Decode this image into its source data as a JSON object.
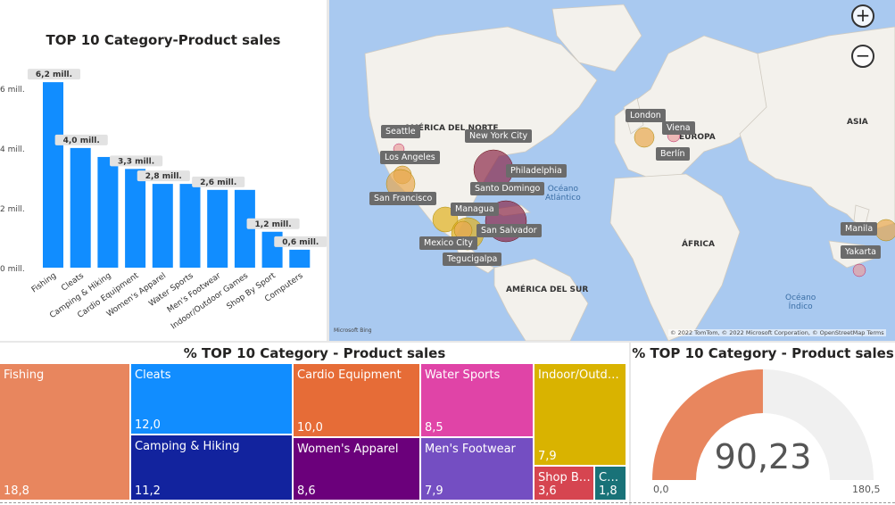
{
  "bar_chart": {
    "title": "TOP 10 Category-Product sales",
    "y_ticks": [
      "0 mill.",
      "2 mill.",
      "4 mill.",
      "6 mill."
    ],
    "bar_color": "#118DFF",
    "chart_data": {
      "type": "bar",
      "title": "TOP 10 Category-Product sales",
      "categories": [
        "Fishing",
        "Cleats",
        "Camping & Hiking",
        "Cardio Equipment",
        "Women's Apparel",
        "Water Sports",
        "Men's Footwear",
        "Indoor/Outdoor Games",
        "Shop By Sport",
        "Computers"
      ],
      "values": [
        6.2,
        4.0,
        3.7,
        3.3,
        2.8,
        2.8,
        2.6,
        2.6,
        1.2,
        0.6
      ],
      "data_labels": [
        "6,2 mill.",
        "4,0 mill.",
        "",
        "3,3 mill.",
        "2,8 mill.",
        "",
        "2,6 mill.",
        "",
        "1,2 mill.",
        "0,6 mill."
      ],
      "ylim": [
        0,
        6.8
      ]
    }
  },
  "map": {
    "continents": [
      "AMÉRICA DEL NORTE",
      "EUROPA",
      "ASIA",
      "ÁFRICA",
      "AMÉRICA DEL SUR"
    ],
    "oceans": [
      [
        "Océano",
        "Atlántico"
      ],
      [
        "Océano",
        "Índico"
      ]
    ],
    "cities": [
      "Seattle",
      "New York City",
      "Los Angeles",
      "Philadelphia",
      "San Francisco",
      "Santo Domingo",
      "Managua",
      "San Salvador",
      "Mexico City",
      "Tegucigalpa",
      "London",
      "Viena",
      "Berlín",
      "Manila",
      "Yakarta"
    ],
    "zoom_in": "+",
    "zoom_out": "−",
    "attribution": "© 2022 TomTom, © 2022 Microsoft Corporation, © OpenStreetMap  Terms",
    "logo": "Microsoft Bing"
  },
  "treemap": {
    "title": "% TOP 10 Category - Product sales",
    "cells": [
      {
        "label": "Fishing",
        "value": "18,8",
        "color": "#E8865E"
      },
      {
        "label": "Cleats",
        "value": "12,0",
        "color": "#118DFF"
      },
      {
        "label": "Camping & Hiking",
        "value": "11,2",
        "color": "#12239E"
      },
      {
        "label": "Cardio Equipment",
        "value": "10,0",
        "color": "#E66C37"
      },
      {
        "label": "Women's Apparel",
        "value": "8,6",
        "color": "#6B007B"
      },
      {
        "label": "Water Sports",
        "value": "8,5",
        "color": "#E044A7"
      },
      {
        "label": "Men's Footwear",
        "value": "7,9",
        "color": "#744EC2"
      },
      {
        "label": "Indoor/Outdoo...",
        "value": "7,9",
        "color": "#D9B300"
      },
      {
        "label": "Shop By ...",
        "value": "3,6",
        "color": "#D64550"
      },
      {
        "label": "Co...",
        "value": "1,8",
        "color": "#197278"
      }
    ]
  },
  "gauge": {
    "title": "% TOP 10 Category - Product sales",
    "value": 90.23,
    "value_label": "90,23",
    "min_label": "0,0",
    "max_label": "180,5",
    "min": 0,
    "max": 180.5,
    "fill_color": "#E8865E",
    "track_color": "#F0F0F0"
  }
}
